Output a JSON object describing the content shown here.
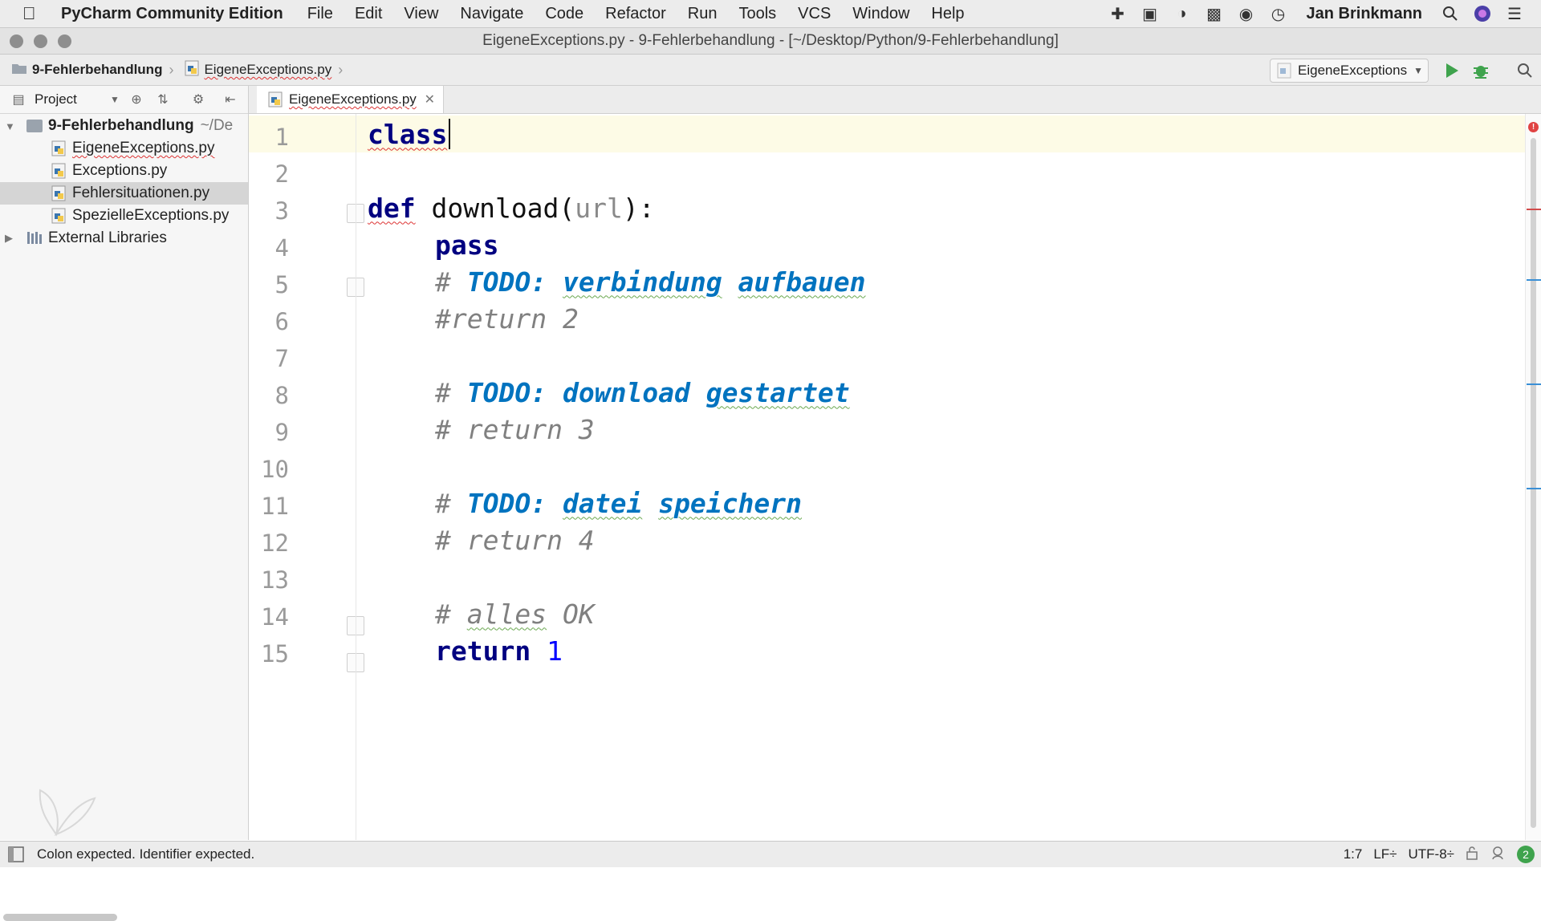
{
  "menubar": {
    "app_name": "PyCharm Community Edition",
    "items": [
      "File",
      "Edit",
      "View",
      "Navigate",
      "Code",
      "Refactor",
      "Run",
      "Tools",
      "VCS",
      "Window",
      "Help"
    ],
    "user": "Jan Brinkmann",
    "tray_icons": [
      "plus-icon",
      "camera-icon",
      "leaf-icon",
      "video-icon",
      "chat-icon",
      "clock-icon",
      "search-icon",
      "siri-icon",
      "list-icon"
    ]
  },
  "window": {
    "title": "EigeneExceptions.py - 9-Fehlerbehandlung - [~/Desktop/Python/9-Fehlerbehandlung]"
  },
  "navbar": {
    "breadcrumb_project": "9-Fehlerbehandlung",
    "breadcrumb_file": "EigeneExceptions.py",
    "run_config": "EigeneExceptions"
  },
  "project_panel": {
    "title": "Project",
    "root_name": "9-Fehlerbehandlung",
    "root_path": "~/De",
    "files": [
      "EigeneExceptions.py",
      "Exceptions.py",
      "Fehlersituationen.py",
      "SpezielleExceptions.py"
    ],
    "selected_file": "Fehlersituationen.py",
    "external": "External Libraries"
  },
  "editor": {
    "tab_label": "EigeneExceptions.py",
    "line_numbers": [
      "1",
      "2",
      "3",
      "4",
      "5",
      "6",
      "7",
      "8",
      "9",
      "10",
      "11",
      "12",
      "13",
      "14",
      "15"
    ],
    "code": {
      "l1_kw": "class",
      "l3_kw": "def",
      "l3_name": " download(",
      "l3_param": "url",
      "l3_end": "):",
      "l4_kw": "pass",
      "l5_hash": "# ",
      "l5_todo": "TODO:",
      "l5_w1": "verbindung",
      "l5_w2": "aufbauen",
      "l6": "#return 2",
      "l8_hash": "# ",
      "l8_todo": "TODO:",
      "l8_w1": "download",
      "l8_w2": "gestartet",
      "l9": "# return 3",
      "l11_hash": "# ",
      "l11_todo": "TODO:",
      "l11_w1": "datei",
      "l11_w2": "speichern",
      "l12": "# return 4",
      "l14_hash": "# ",
      "l14_w1": "alles",
      "l14_w2": " OK",
      "l15_kw": "return",
      "l15_num": "1"
    }
  },
  "statusbar": {
    "message": "Colon expected. Identifier expected.",
    "position": "1:7",
    "line_sep": "LF÷",
    "encoding": "UTF-8÷",
    "notifications": "2"
  },
  "colors": {
    "keyword": "#000080",
    "todo": "#0073bf",
    "comment": "#808080",
    "error": "#e04343"
  }
}
